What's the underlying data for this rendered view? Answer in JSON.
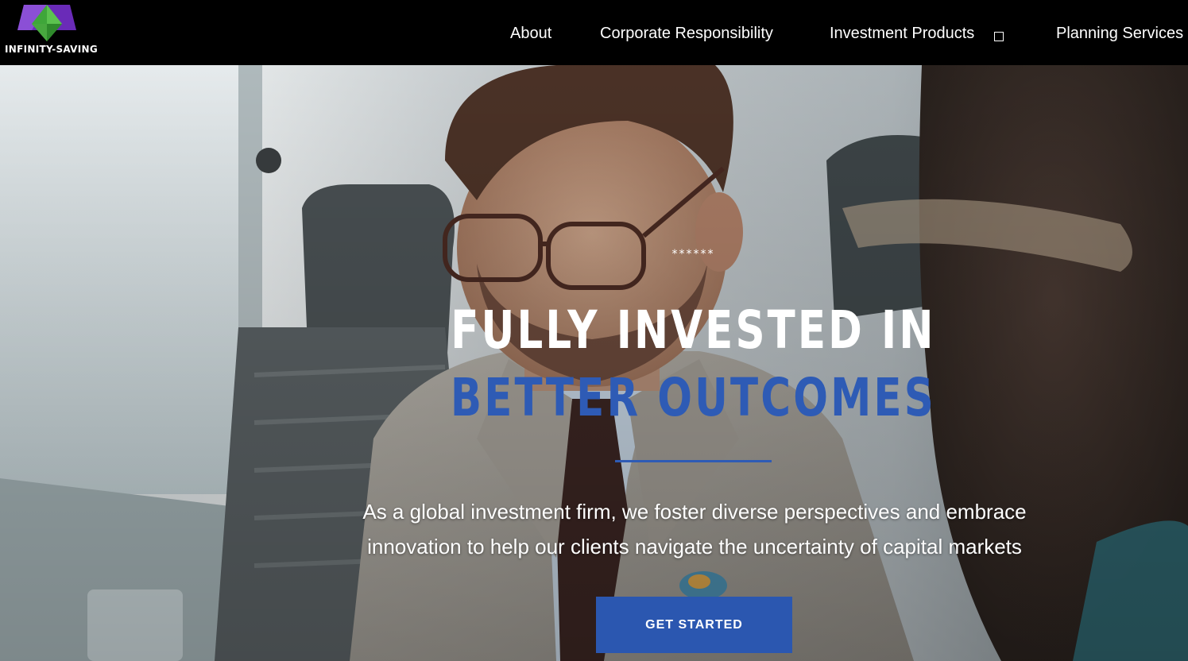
{
  "brand": {
    "name": "INFINITY-SAVING",
    "logo_icon": "pyramid-gem-icon"
  },
  "nav": {
    "items": [
      {
        "label": "About"
      },
      {
        "label": "Corporate Responsibility"
      },
      {
        "label": "Investment Products",
        "has_dropdown": true
      },
      {
        "label": "Planning Services"
      }
    ]
  },
  "hero": {
    "stars": "******",
    "title_line1": "FULLY INVESTED IN",
    "title_line2": "BETTER OUTCOMES",
    "subtitle": "As a global investment firm, we foster diverse perspectives and embrace innovation to help our clients navigate the uncertainty of capital markets",
    "cta_label": "GET STARTED",
    "image": "hero-photo-businessman"
  },
  "colors": {
    "nav_background": "#000000",
    "accent_blue": "#2e5bb5",
    "button_blue": "#2b57b0",
    "text_white": "#ffffff"
  }
}
